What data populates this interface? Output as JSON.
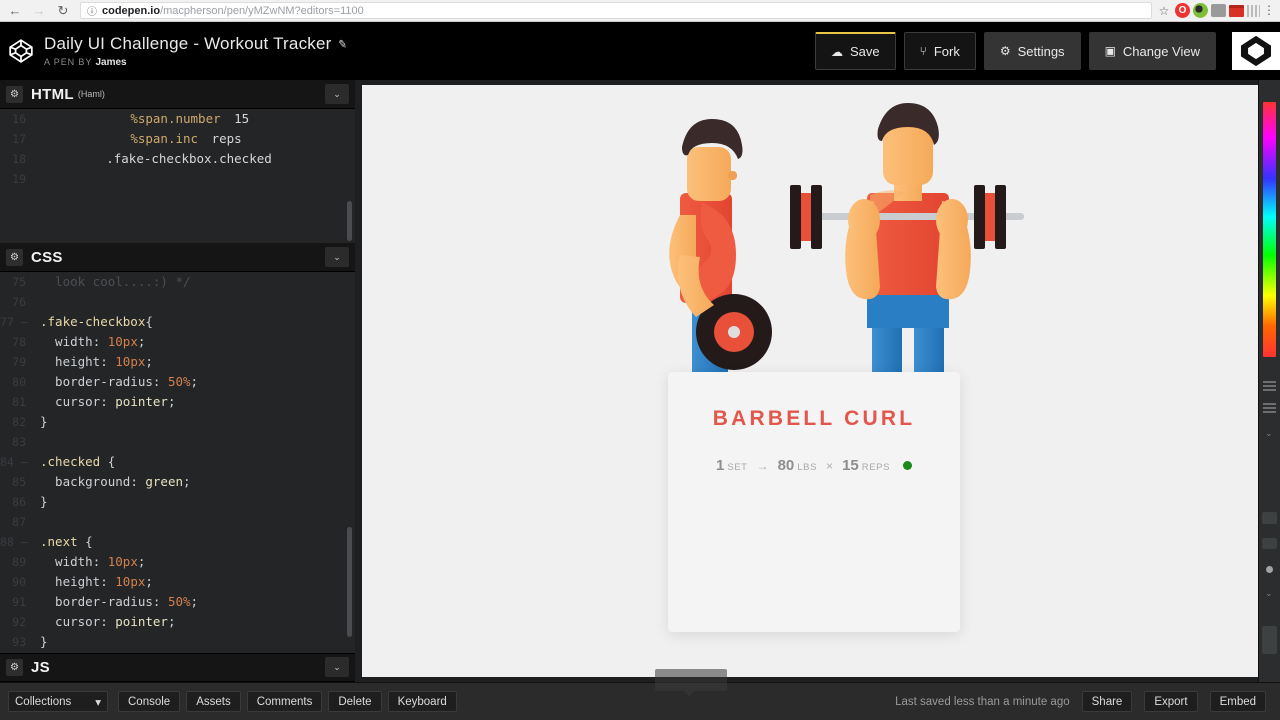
{
  "browser": {
    "back_icon": "back-arrow-icon",
    "forward_icon": "forward-arrow-icon",
    "reload_icon": "reload-icon",
    "info_icon": "ⓘ",
    "url_domain": "codepen.io",
    "url_path": "/macpherson/pen/yMZwNM?editors=1100",
    "star_icon": "☆",
    "ext_o_label": "O",
    "menu_icon": "⋮"
  },
  "header": {
    "pen_title": "Daily UI Challenge - Workout Tracker",
    "pencil_icon": "✎",
    "by_prefix": "A PEN BY",
    "author": "James",
    "buttons": [
      {
        "label": "Save",
        "icon": "☁"
      },
      {
        "label": "Fork",
        "icon": "⑂"
      },
      {
        "label": "Settings",
        "icon": "⚙"
      },
      {
        "label": "Change View",
        "icon": "▣"
      }
    ]
  },
  "editors": {
    "html": {
      "name": "HTML",
      "sub": "(Haml)",
      "gear_icon": "⚙",
      "chevron_icon": "⌄",
      "lines": [
        {
          "n": "16",
          "fold": false,
          "parts": [
            {
              "t": "            ",
              "c": "punc"
            },
            {
              "t": "%span.number",
              "c": "tag"
            },
            {
              "t": " 15",
              "c": "ctext"
            }
          ]
        },
        {
          "n": "17",
          "fold": false,
          "parts": [
            {
              "t": "            ",
              "c": "punc"
            },
            {
              "t": "%span.inc",
              "c": "tag"
            },
            {
              "t": " reps",
              "c": "ctext"
            }
          ]
        },
        {
          "n": "18",
          "fold": false,
          "parts": [
            {
              "t": "        ",
              "c": "punc"
            },
            {
              "t": ".fake-checkbox.checked",
              "c": "ctext"
            }
          ]
        },
        {
          "n": "19",
          "fold": false,
          "parts": [
            {
              "t": "",
              "c": "ctext"
            }
          ]
        }
      ]
    },
    "css": {
      "name": "CSS",
      "sub": "",
      "gear_icon": "⚙",
      "chevron_icon": "⌄",
      "lines": [
        {
          "n": "75",
          "fold": false,
          "parts": [
            {
              "t": "  look cool....:) */",
              "c": "dim"
            }
          ]
        },
        {
          "n": "76",
          "fold": false,
          "parts": [
            {
              "t": "",
              "c": "ctext"
            }
          ]
        },
        {
          "n": "77",
          "fold": true,
          "parts": [
            {
              "t": ".fake-checkbox",
              "c": "sel"
            },
            {
              "t": "{",
              "c": "punc"
            }
          ]
        },
        {
          "n": "78",
          "fold": false,
          "parts": [
            {
              "t": "  width",
              "c": "prop"
            },
            {
              "t": ": ",
              "c": "punc"
            },
            {
              "t": "10px",
              "c": "num"
            },
            {
              "t": ";",
              "c": "punc"
            }
          ]
        },
        {
          "n": "79",
          "fold": false,
          "parts": [
            {
              "t": "  height",
              "c": "prop"
            },
            {
              "t": ": ",
              "c": "punc"
            },
            {
              "t": "10px",
              "c": "num"
            },
            {
              "t": ";",
              "c": "punc"
            }
          ]
        },
        {
          "n": "80",
          "fold": false,
          "parts": [
            {
              "t": "  border-radius",
              "c": "prop"
            },
            {
              "t": ": ",
              "c": "punc"
            },
            {
              "t": "50%",
              "c": "num"
            },
            {
              "t": ";",
              "c": "punc"
            }
          ]
        },
        {
          "n": "81",
          "fold": false,
          "parts": [
            {
              "t": "  cursor",
              "c": "prop"
            },
            {
              "t": ": ",
              "c": "punc"
            },
            {
              "t": "pointer",
              "c": "val"
            },
            {
              "t": ";",
              "c": "punc"
            }
          ]
        },
        {
          "n": "82",
          "fold": false,
          "parts": [
            {
              "t": "}",
              "c": "punc"
            }
          ]
        },
        {
          "n": "83",
          "fold": false,
          "parts": [
            {
              "t": "",
              "c": "ctext"
            }
          ]
        },
        {
          "n": "84",
          "fold": true,
          "parts": [
            {
              "t": ".checked",
              "c": "sel"
            },
            {
              "t": " {",
              "c": "punc"
            }
          ]
        },
        {
          "n": "85",
          "fold": false,
          "parts": [
            {
              "t": "  background",
              "c": "prop"
            },
            {
              "t": ": ",
              "c": "punc"
            },
            {
              "t": "green",
              "c": "val"
            },
            {
              "t": ";",
              "c": "punc"
            }
          ]
        },
        {
          "n": "86",
          "fold": false,
          "parts": [
            {
              "t": "}",
              "c": "punc"
            }
          ]
        },
        {
          "n": "87",
          "fold": false,
          "parts": [
            {
              "t": "",
              "c": "ctext"
            }
          ]
        },
        {
          "n": "88",
          "fold": true,
          "parts": [
            {
              "t": ".next",
              "c": "sel"
            },
            {
              "t": " {",
              "c": "punc"
            }
          ]
        },
        {
          "n": "89",
          "fold": false,
          "parts": [
            {
              "t": "  width",
              "c": "prop"
            },
            {
              "t": ": ",
              "c": "punc"
            },
            {
              "t": "10px",
              "c": "num"
            },
            {
              "t": ";",
              "c": "punc"
            }
          ]
        },
        {
          "n": "90",
          "fold": false,
          "parts": [
            {
              "t": "  height",
              "c": "prop"
            },
            {
              "t": ": ",
              "c": "punc"
            },
            {
              "t": "10px",
              "c": "num"
            },
            {
              "t": ";",
              "c": "punc"
            }
          ]
        },
        {
          "n": "91",
          "fold": false,
          "parts": [
            {
              "t": "  border-radius",
              "c": "prop"
            },
            {
              "t": ": ",
              "c": "punc"
            },
            {
              "t": "50%",
              "c": "num"
            },
            {
              "t": ";",
              "c": "punc"
            }
          ]
        },
        {
          "n": "92",
          "fold": false,
          "parts": [
            {
              "t": "  cursor",
              "c": "prop"
            },
            {
              "t": ": ",
              "c": "punc"
            },
            {
              "t": "pointer",
              "c": "val"
            },
            {
              "t": ";",
              "c": "punc"
            }
          ]
        },
        {
          "n": "93",
          "fold": false,
          "parts": [
            {
              "t": "}",
              "c": "punc"
            }
          ]
        }
      ]
    },
    "js": {
      "name": "JS",
      "sub": "",
      "gear_icon": "⚙",
      "chevron_icon": "⌄"
    }
  },
  "preview": {
    "card": {
      "title": "BARBELL CURL",
      "sets_value": "1",
      "sets_unit": "SET",
      "arrow": "→",
      "weight_value": "80",
      "weight_unit": "LBS",
      "times": "×",
      "reps_value": "15",
      "reps_unit": "REPS",
      "status_color": "#1a8a1a"
    },
    "illustration": {
      "name": "two-weightlifter-figures",
      "skin_color": "#f8b26a",
      "shirt_color": "#e8503a",
      "pants_color": "#2a7fc4",
      "hair_color": "#3b2a2a",
      "weight_color": "#2a1f1f"
    }
  },
  "footer": {
    "collections_label": "Collections",
    "collections_caret": "▾",
    "buttons": [
      "Console",
      "Assets",
      "Comments",
      "Delete",
      "Keyboard"
    ],
    "saved_text": "Last saved less than a minute ago",
    "right_buttons": [
      "Share",
      "Export",
      "Embed"
    ]
  }
}
